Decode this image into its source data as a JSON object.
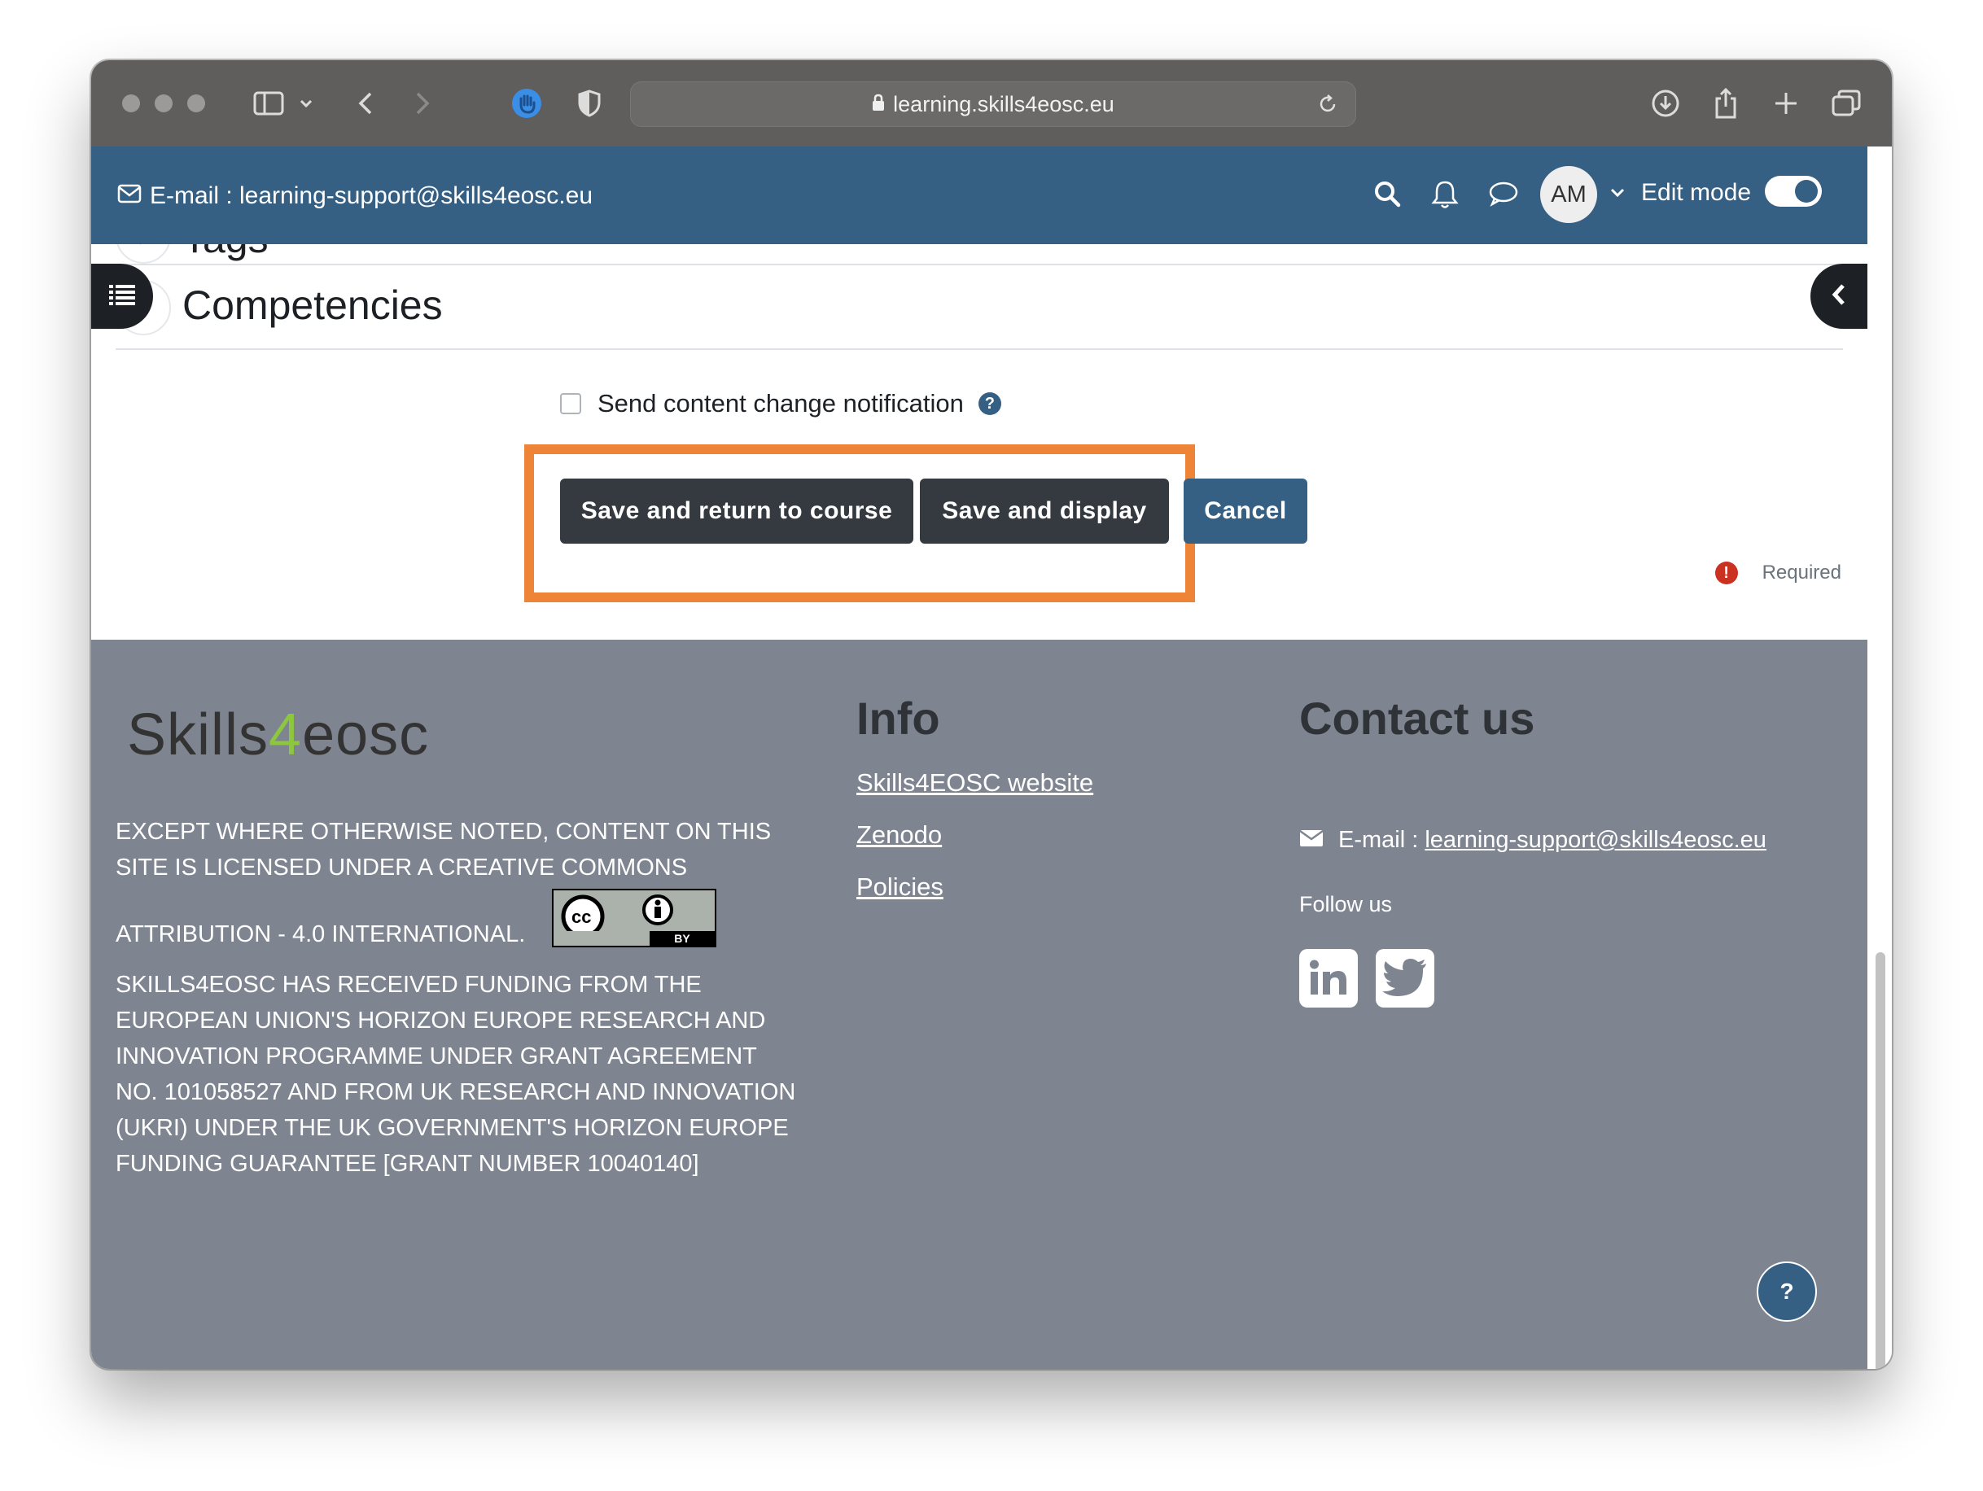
{
  "browser": {
    "url": "learning.skills4eosc.eu"
  },
  "navbar": {
    "email_text": "E-mail : learning-support@skills4eosc.eu",
    "avatar_initials": "AM",
    "edit_mode_label": "Edit mode",
    "edit_mode_on": true
  },
  "form": {
    "sections": [
      {
        "label": "Tags"
      },
      {
        "label": "Competencies"
      }
    ],
    "notification_label": "Send content change notification",
    "notification_checked": false,
    "buttons": {
      "save_return": "Save and return to course",
      "save_display": "Save and display",
      "cancel": "Cancel"
    },
    "required_label": "Required"
  },
  "footer": {
    "logo": {
      "part1": "Skills",
      "part2": "4",
      "part3": "eosc"
    },
    "license_text_1": "EXCEPT WHERE OTHERWISE NOTED, CONTENT ON THIS SITE IS LICENSED UNDER A CREATIVE COMMONS",
    "license_text_2": "ATTRIBUTION - 4.0 INTERNATIONAL.",
    "cc_badge": {
      "cc": "cc",
      "by": "BY"
    },
    "funding_text": "SKILLS4EOSC HAS RECEIVED FUNDING FROM THE EUROPEAN UNION'S HORIZON EUROPE  RESEARCH AND INNOVATION PROGRAMME UNDER GRANT AGREEMENT NO. 101058527 AND FROM UK RESEARCH AND INNOVATION (UKRI) UNDER THE UK GOVERNMENT'S HORIZON EUROPE FUNDING GUARANTEE [GRANT NUMBER 10040140]",
    "info": {
      "title": "Info",
      "links": [
        "Skills4EOSC website",
        "Zenodo",
        "Policies"
      ]
    },
    "contact": {
      "title": "Contact us",
      "email_prefix": "E-mail : ",
      "email": "learning-support@skills4eosc.eu",
      "follow_label": "Follow us",
      "social_icons": [
        "linkedin-icon",
        "twitter-icon"
      ]
    },
    "help_button": "?"
  },
  "colors": {
    "navbar": "#355f83",
    "footer": "#7e8590",
    "highlight": "#ee8437",
    "dark_button": "#343a40"
  }
}
